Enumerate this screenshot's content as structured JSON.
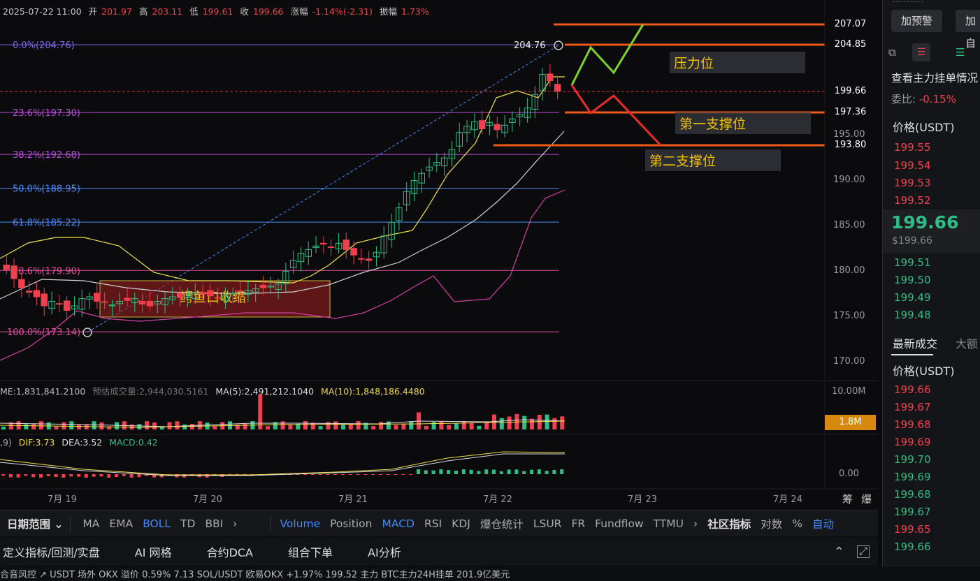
{
  "ohlc": {
    "datetime": "2025-07-22 11:00",
    "open_label": "开",
    "open": "201.97",
    "high_label": "高",
    "high": "203.11",
    "low_label": "低",
    "low": "199.61",
    "close_label": "收",
    "close": "199.66",
    "change_label": "涨幅",
    "change": "-1.14%(-2.31)",
    "amp_label": "振幅",
    "amp": "1.73%"
  },
  "fib_levels": [
    {
      "label": "0.0%(204.76)",
      "color": "#7b68ee"
    },
    {
      "label": "23.6%(197.30)",
      "color": "#b84dd6"
    },
    {
      "label": "38.2%(192.68)",
      "color": "#b84dd6"
    },
    {
      "label": "50.0%(188.95)",
      "color": "#4a8af4"
    },
    {
      "label": "61.8%(185.22)",
      "color": "#4a8af4"
    },
    {
      "label": "78.6%(179.90)",
      "color": "#e04fa0"
    },
    {
      "label": "100.0%(173.14)",
      "color": "#e04fa0"
    }
  ],
  "annotations": {
    "peak_value": "204.76",
    "pressure": "压力位",
    "support1": "第一支撑位",
    "support2": "第二支撑位",
    "squeeze": "鳄鱼口收缩"
  },
  "price_tags": [
    {
      "text": "207.07",
      "color": "#f05a1a"
    },
    {
      "text": "204.85",
      "color": "#f05a1a"
    },
    {
      "text": "199.66",
      "color": "#e8333c"
    },
    {
      "text": "197.36",
      "color": "#f05a1a"
    },
    {
      "text": "193.80",
      "color": "#f05a1a"
    }
  ],
  "y_axis": [
    "195.00",
    "190.00",
    "185.00",
    "180.00",
    "175.00",
    "170.00"
  ],
  "volume": {
    "vol_label": "ME:1,831,841.2100",
    "est_label": "预估成交量:2,944,030.5161",
    "ma5_label": "MA(5):2,491,212.1040",
    "ma10_label": "MA(10):1,848,186.4480",
    "axis_top": "10.00M",
    "tag": "1.8M"
  },
  "macd": {
    "params": ",9)",
    "dif": "DIF:3.73",
    "dea": "DEA:3.52",
    "macd": "MACD:0.42",
    "axis_zero": "0.00"
  },
  "x_axis": [
    "7月 19",
    "7月 20",
    "7月 21",
    "7月 22",
    "7月 23",
    "7月 24"
  ],
  "x_axis_right": [
    "筹",
    "爆"
  ],
  "indicator_bar": {
    "range_label": "日期范围",
    "indicators": [
      "MA",
      "EMA",
      "BOLL",
      "TD",
      "BBI"
    ],
    "sub_indicators": [
      "Volume",
      "Position",
      "MACD",
      "RSI",
      "KDJ",
      "爆仓统计",
      "LSUR",
      "FR",
      "Fundflow",
      "TTMU"
    ],
    "community": "社区指标",
    "log": "对数",
    "percent": "%",
    "auto": "自动"
  },
  "bottom_toolbar": [
    "定义指标/回测/实盘",
    "AI 网格",
    "合约DCA",
    "组合下单",
    "AI分析"
  ],
  "ticker_strip": "合音风控    ↗  USDT 场外  OKX  溢价  0.59%  7.13      SOL/USDT 欧易OKX  +1.97%  199.52       主力   BTC主力24H挂单  201.9亿美元",
  "side_panel": {
    "add_alert": "加预警",
    "add2": "加自",
    "order_title": "查看主力挂单情况",
    "ratio_label": "委比:",
    "ratio_value": "-0.15%",
    "price_header": "价格(USDT)",
    "asks": [
      "199.55",
      "199.54",
      "199.53",
      "199.52"
    ],
    "last_price": "199.66",
    "last_price_usd": "$199.66",
    "bids": [
      "199.51",
      "199.50",
      "199.49",
      "199.48"
    ],
    "trades_tab": "最新成交",
    "big_tab": "大额",
    "trades_header": "价格(USDT)",
    "trades": [
      {
        "p": "199.66",
        "c": "red"
      },
      {
        "p": "199.67",
        "c": "red"
      },
      {
        "p": "199.68",
        "c": "red"
      },
      {
        "p": "199.69",
        "c": "red"
      },
      {
        "p": "199.70",
        "c": "green"
      },
      {
        "p": "199.69",
        "c": "green"
      },
      {
        "p": "199.68",
        "c": "green"
      },
      {
        "p": "199.67",
        "c": "green"
      },
      {
        "p": "199.65",
        "c": "red"
      },
      {
        "p": "199.66",
        "c": "green"
      }
    ]
  },
  "colors": {
    "up": "#2ebd85",
    "down": "#f0404d",
    "boll_mid": "#cfcfcf",
    "boll_up": "#f2e24b",
    "boll_low": "#d63fa8",
    "accent": "#3d8bff"
  }
}
